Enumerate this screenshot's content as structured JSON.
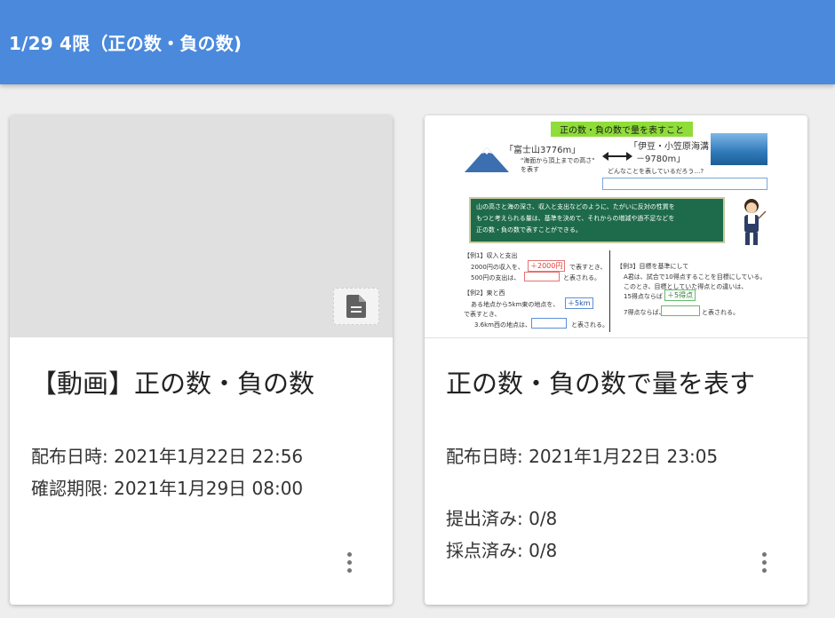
{
  "header": {
    "title": "1/29 4限（正の数・負の数)"
  },
  "cards": [
    {
      "title": "【動画】正の数・負の数",
      "distributed": "配布日時: 2021年1月22日 22:56",
      "deadline": "確認期限: 2021年1月29日 08:00",
      "thumbnail_icon": "document-icon"
    },
    {
      "title": "正の数・負の数で量を表す",
      "distributed": "配布日時: 2021年1月22日 23:05",
      "submitted": "提出済み: 0/8",
      "graded": "採点済み: 0/8",
      "worksheet": {
        "heading": "正の数・負の数で量を表すこと",
        "mountain_label": "「富士山3776m」",
        "mountain_sub": "\"海面から頂上までの高さ\"",
        "mountain_sub2": "を表す",
        "trench_label": "「伊豆・小笠原海溝",
        "trench_value": "－9780m」",
        "question": "どんなことを表しているだろう…?",
        "box_line1": "山の高さと海の深さ、収入と支出などのように、たがいに反対の性質を",
        "box_line2": "もつと考えられる量は、基準を決めて、それからの増減や過不足などを",
        "box_line3": "正の数・負の数で表すことができる。",
        "ex1_title": "【例1】収入と支出",
        "ex1_line1": "2000円の収入を、",
        "ex1_ans": "＋2000円",
        "ex1_line1b": "で表すとき、",
        "ex1_line2": "500円の支出は、",
        "ex1_line2b": "と表される。",
        "ex2_title": "【例2】東と西",
        "ex2_line1": "ある地点から5km東の地点を、",
        "ex2_ans": "＋5km",
        "ex2_line1b": "で表すとき、",
        "ex2_line2": "3.6km西の地点は、",
        "ex2_line2b": "と表される。",
        "ex3_title": "【例3】目標を基準にして",
        "ex3_line1": "A君は、試合で10得点することを目標にしている。",
        "ex3_line2": "このとき、目標としていた得点との違いは、",
        "ex3_line3": "15得点ならば",
        "ex3_ans": "＋5得点",
        "ex3_line4": "7得点ならば、",
        "ex3_line4b": "と表される。"
      }
    }
  ],
  "colors": {
    "header": "#4a89dc",
    "board": "#1e6b4b",
    "heading_bg": "#8fdc3a"
  }
}
